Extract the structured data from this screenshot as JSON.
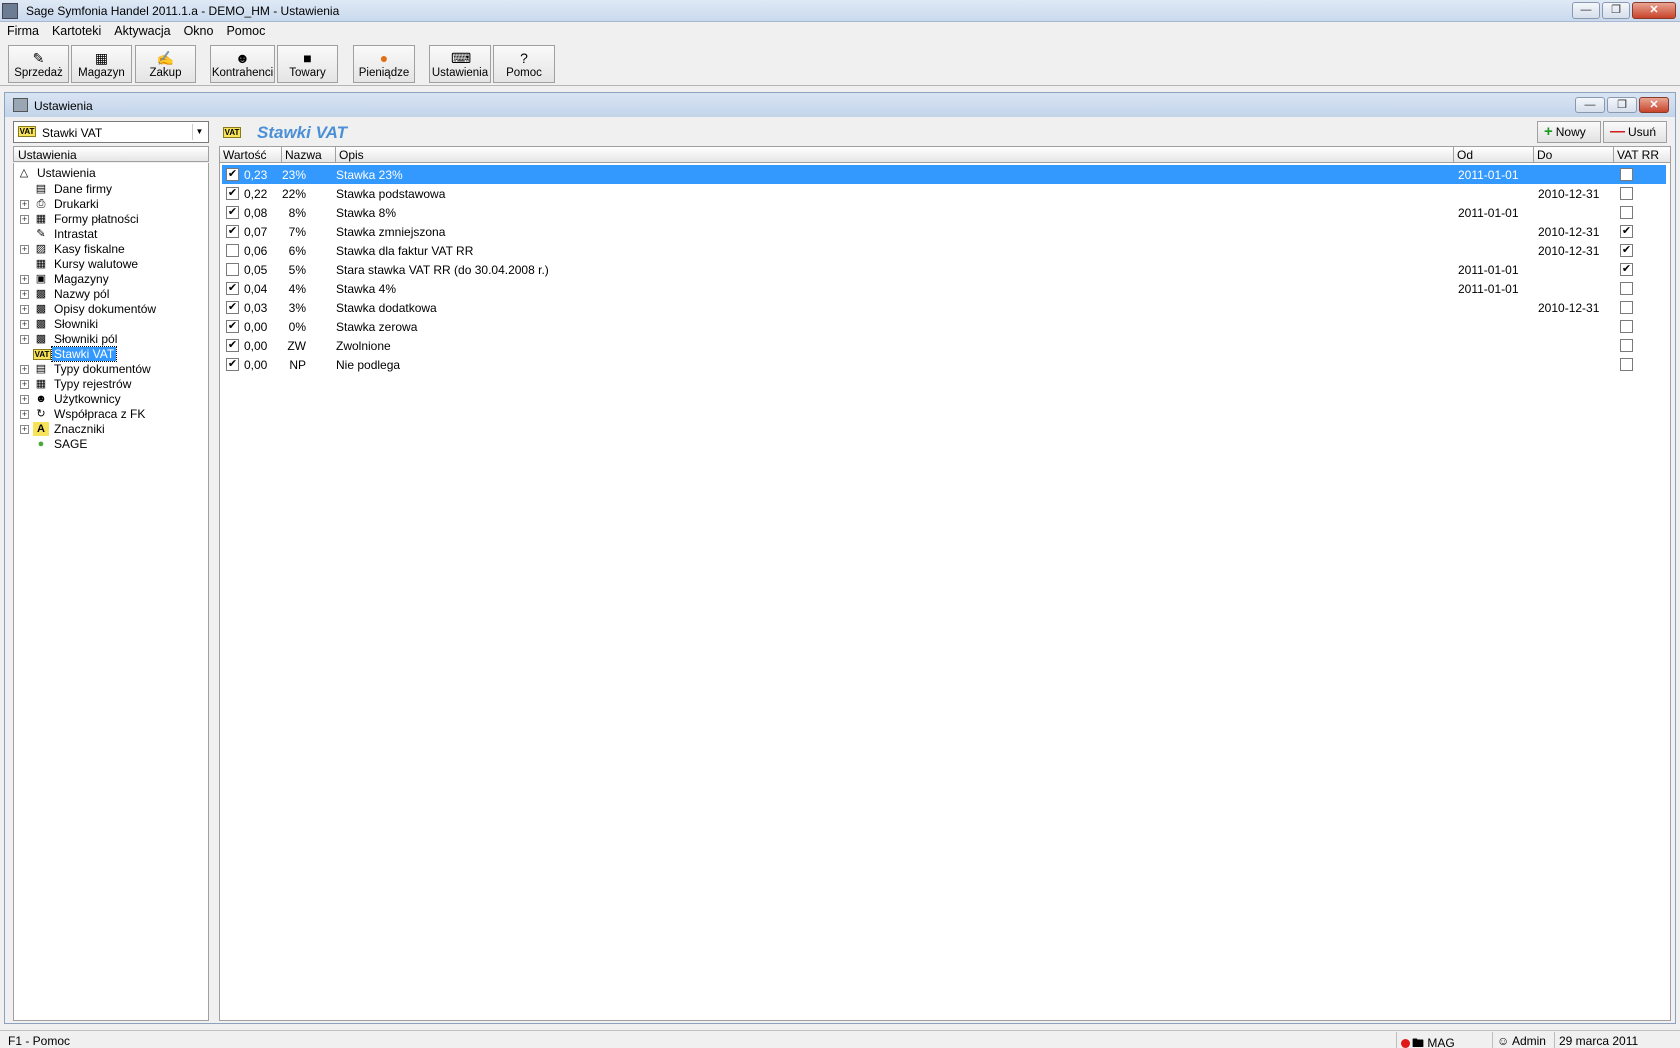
{
  "window": {
    "title": "Sage Symfonia Handel 2011.1.a - DEMO_HM - Ustawienia"
  },
  "menu": [
    "Firma",
    "Kartoteki",
    "Aktywacja",
    "Okno",
    "Pomoc"
  ],
  "toolbar": [
    {
      "label": "Sprzedaż",
      "icon": "sales-icon"
    },
    {
      "label": "Magazyn",
      "icon": "warehouse-icon"
    },
    {
      "label": "Zakup",
      "icon": "purchase-icon"
    },
    {
      "label": "Kontrahenci",
      "icon": "contractors-icon"
    },
    {
      "label": "Towary",
      "icon": "goods-icon"
    },
    {
      "label": "Pieniądze",
      "icon": "money-icon"
    },
    {
      "label": "Ustawienia",
      "icon": "settings-icon"
    },
    {
      "label": "Pomoc",
      "icon": "help-icon"
    }
  ],
  "child_window": {
    "title": "Ustawienia"
  },
  "combo": {
    "icon_text": "VAT",
    "value": "Stawki VAT"
  },
  "tree": {
    "header": "Ustawienia",
    "root": "Ustawienia",
    "items": [
      {
        "label": "Dane firmy",
        "icon": "company-data-icon",
        "expandable": false
      },
      {
        "label": "Drukarki",
        "icon": "printer-icon",
        "expandable": true
      },
      {
        "label": "Formy płatności",
        "icon": "payment-forms-icon",
        "expandable": true
      },
      {
        "label": "Intrastat",
        "icon": "intrastat-icon",
        "expandable": false
      },
      {
        "label": "Kasy fiskalne",
        "icon": "cash-register-icon",
        "expandable": true
      },
      {
        "label": "Kursy walutowe",
        "icon": "exchange-rates-icon",
        "expandable": false
      },
      {
        "label": "Magazyny",
        "icon": "warehouses-icon",
        "expandable": true
      },
      {
        "label": "Nazwy pól",
        "icon": "field-names-icon",
        "expandable": true
      },
      {
        "label": "Opisy dokumentów",
        "icon": "document-descriptions-icon",
        "expandable": true
      },
      {
        "label": "Słowniki",
        "icon": "dictionaries-icon",
        "expandable": true
      },
      {
        "label": "Słowniki pól",
        "icon": "field-dictionaries-icon",
        "expandable": true
      },
      {
        "label": "Stawki VAT",
        "icon": "vat-icon",
        "expandable": false,
        "selected": true
      },
      {
        "label": "Typy dokumentów",
        "icon": "document-types-icon",
        "expandable": true
      },
      {
        "label": "Typy rejestrów",
        "icon": "register-types-icon",
        "expandable": true
      },
      {
        "label": "Użytkownicy",
        "icon": "users-icon",
        "expandable": true
      },
      {
        "label": "Współpraca z FK",
        "icon": "fk-cooperation-icon",
        "expandable": true
      },
      {
        "label": "Znaczniki",
        "icon": "markers-icon",
        "expandable": true
      },
      {
        "label": "SAGE",
        "icon": "sage-icon",
        "expandable": false
      }
    ]
  },
  "panel": {
    "badge": "VAT",
    "title": "Stawki VAT",
    "new_label": "Nowy",
    "delete_label": "Usuń"
  },
  "columns": [
    "Wartość",
    "Nazwa",
    "Opis",
    "Od",
    "Do",
    "VAT RR"
  ],
  "rows": [
    {
      "active": true,
      "value": "0,23",
      "name": "23%",
      "desc": "Stawka 23%",
      "od": "2011-01-01",
      "do": "",
      "vatrr": false
    },
    {
      "active": true,
      "value": "0,22",
      "name": "22%",
      "desc": "Stawka podstawowa",
      "od": "",
      "do": "2010-12-31",
      "vatrr": false
    },
    {
      "active": true,
      "value": "0,08",
      "name": "8%",
      "desc": "Stawka 8%",
      "od": "2011-01-01",
      "do": "",
      "vatrr": false
    },
    {
      "active": true,
      "value": "0,07",
      "name": "7%",
      "desc": "Stawka zmniejszona",
      "od": "",
      "do": "2010-12-31",
      "vatrr": true
    },
    {
      "active": false,
      "value": "0,06",
      "name": "6%",
      "desc": "Stawka dla faktur VAT RR",
      "od": "",
      "do": "2010-12-31",
      "vatrr": true
    },
    {
      "active": false,
      "value": "0,05",
      "name": "5%",
      "desc": "Stara stawka VAT RR (do 30.04.2008 r.)",
      "od": "2011-01-01",
      "do": "",
      "vatrr": true
    },
    {
      "active": true,
      "value": "0,04",
      "name": "4%",
      "desc": "Stawka 4%",
      "od": "2011-01-01",
      "do": "",
      "vatrr": false
    },
    {
      "active": true,
      "value": "0,03",
      "name": "3%",
      "desc": "Stawka dodatkowa",
      "od": "",
      "do": "2010-12-31",
      "vatrr": false
    },
    {
      "active": true,
      "value": "0,00",
      "name": "0%",
      "desc": "Stawka zerowa",
      "od": "",
      "do": "",
      "vatrr": false
    },
    {
      "active": true,
      "value": "0,00",
      "name": "ZW",
      "desc": "Zwolnione",
      "od": "",
      "do": "",
      "vatrr": false
    },
    {
      "active": true,
      "value": "0,00",
      "name": "NP",
      "desc": "Nie podlega",
      "od": "",
      "do": "",
      "vatrr": false
    }
  ],
  "status": {
    "help": "F1 - Pomoc",
    "module": "MAG",
    "user": "Admin",
    "date": "29 marca 2011"
  }
}
